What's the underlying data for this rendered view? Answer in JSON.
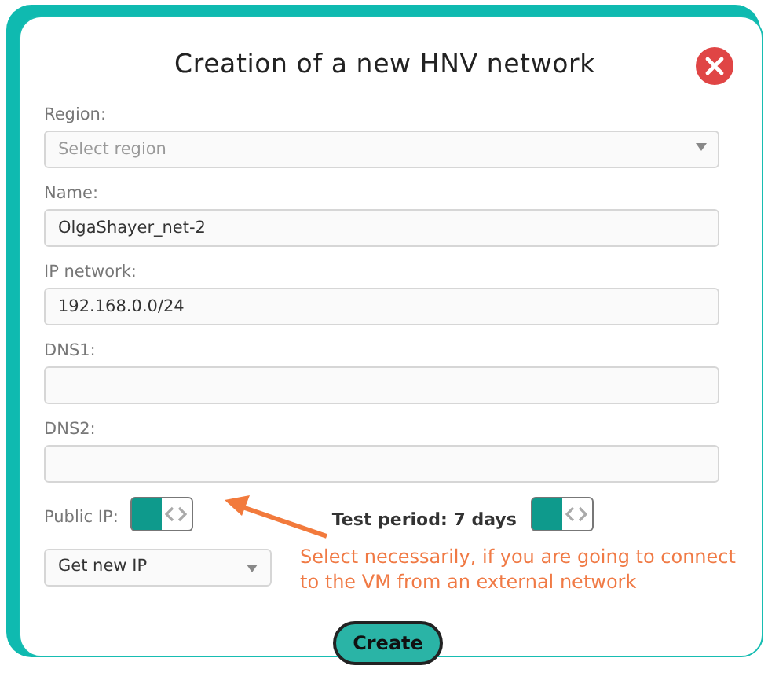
{
  "dialog": {
    "title": "Creation of a new HNV network"
  },
  "fields": [
    {
      "label": "Region:",
      "kind": "select",
      "placeholder": "Select region"
    },
    {
      "label": "Name:",
      "kind": "text",
      "value": "OlgaShayer_net-2"
    },
    {
      "label": "IP network:",
      "kind": "text",
      "value": "192.168.0.0/24"
    },
    {
      "label": "DNS1:",
      "kind": "text"
    },
    {
      "label": "DNS2:",
      "kind": "text"
    }
  ],
  "public_ip": {
    "label": "Public IP:",
    "on": true
  },
  "test_period": {
    "label": "Test period: 7 days",
    "on": true
  },
  "ip_select": {
    "value": "Get new IP"
  },
  "annotation": {
    "text": "Select necessarily, if you are going to connect to the VM from an external network"
  },
  "create_button": {
    "label": "Create"
  }
}
